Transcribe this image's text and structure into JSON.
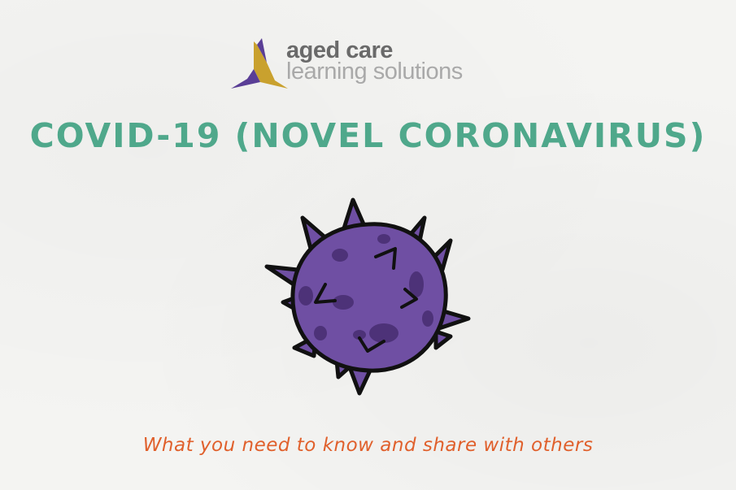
{
  "logo": {
    "line1": "aged care",
    "line2": "learning solutions",
    "icon": "aged-care-logo-mark"
  },
  "title": "COVID-19 (NOVEL CORONAVIRUS)",
  "subtitle": "What you need to know and share with others",
  "illustration": {
    "icon": "virus-illustration"
  },
  "colors": {
    "title": "#4fa88b",
    "subtitle": "#e0602c",
    "virus_body": "#6f4fa3",
    "virus_spots": "#4d3278",
    "logo_purple": "#5a3e96",
    "logo_gold": "#c9a12e",
    "background": "#f4f4f2"
  }
}
